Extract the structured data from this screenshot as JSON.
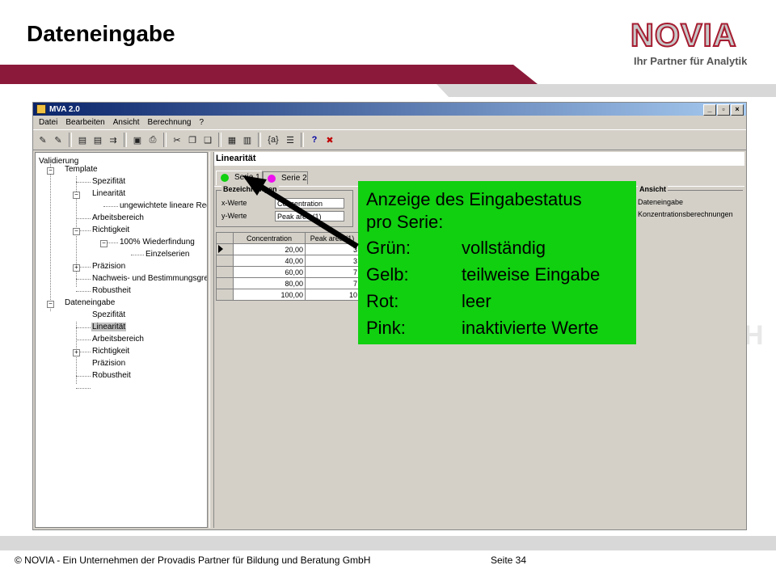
{
  "slide": {
    "title": "Dateneingabe",
    "logo_word": "NOVIA",
    "logo_tagline": "Ihr Partner für Analytik",
    "footer": "© NOVIA - Ein Unternehmen der Provadis Partner für Bildung und Beratung GmbH",
    "page": "Seite 34",
    "ghost_text": "H",
    "colors": {
      "banner": "#8b1a3a",
      "callout": "#10d010",
      "dot_green": "#10d010",
      "dot_pink": "#ee10ee"
    }
  },
  "app": {
    "title": "MVA 2.0",
    "title_buttons": [
      "_",
      "▫",
      "×"
    ],
    "menu": [
      "Datei",
      "Bearbeiten",
      "Ansicht",
      "Berechnung",
      "?"
    ],
    "toolbar_icons": [
      "open-validation-icon",
      "open-folder-icon",
      "document-icon",
      "new-document-icon",
      "transfer-icon",
      "save-icon",
      "print-icon",
      "cut-icon",
      "copy-icon",
      "paste-icon",
      "calculator-icon",
      "bar-chart-icon",
      "variable-icon",
      "list-icon",
      "help-icon",
      "tools-icon"
    ],
    "toolbar_glyphs": [
      "✎",
      "✎",
      "▤",
      "▤",
      "⇉",
      "▣",
      "⎙",
      "✂",
      "❐",
      "❑",
      "▦",
      "▥",
      "{a}",
      "☰",
      "?",
      "✖"
    ],
    "tree": {
      "root": "Validierung",
      "template": "Template",
      "template_items": {
        "spezifitaet": "Spezifität",
        "linearitaet": "Linearität",
        "ungewichtet": "ungewichtete lineare Regre",
        "arbeitsbereich": "Arbeitsbereich",
        "richtigkeit": "Richtigkeit",
        "wiederfindung": "100% Wiederfindung",
        "einzelserien": "Einzelserien",
        "praezision": "Präzision",
        "nachweis": "Nachweis- und Bestimmungsgrenze",
        "robustheit": "Robustheit"
      },
      "dateneingabe": "Dateneingabe",
      "data_items": {
        "spezifitaet": "Spezifität",
        "linearitaet": "Linearität",
        "arbeitsbereich": "Arbeitsbereich",
        "richtigkeit": "Richtigkeit",
        "praezision": "Präzision",
        "robustheit": "Robustheit"
      }
    },
    "section_title": "Linearität",
    "tabs": [
      "Serie 1",
      "Serie 2"
    ],
    "group_label": "Bezeichnungen",
    "x_label": "x-Werte",
    "x_value": "Concentration",
    "y_label": "y-Werte",
    "y_value": "Peak area (1)",
    "grid": {
      "columns": [
        "Concentration",
        "Peak area (1)"
      ],
      "rows": [
        [
          "20,00",
          "3"
        ],
        [
          "40,00",
          "3"
        ],
        [
          "60,00",
          "7"
        ],
        [
          "80,00",
          "7"
        ],
        [
          "100,00",
          "10"
        ]
      ]
    },
    "ansicht": {
      "label": "Ansicht",
      "items": [
        "Dateneingabe",
        "Konzentrationsberechnungen"
      ]
    }
  },
  "callout": {
    "line1": "Anzeige des Eingabestatus",
    "line2": "pro Serie:",
    "rows": [
      {
        "k": "Grün:",
        "v": "vollständig"
      },
      {
        "k": "Gelb:",
        "v": "teilweise Eingabe"
      },
      {
        "k": "Rot:",
        "v": "leer"
      },
      {
        "k": "Pink:",
        "v": "inaktivierte Werte"
      }
    ]
  }
}
